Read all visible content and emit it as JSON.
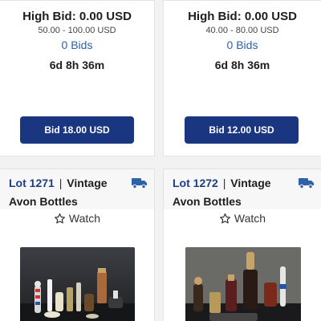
{
  "cards_top": [
    {
      "high_bid": "High Bid: 0.00 USD",
      "range": "50.00 - 100.00 USD",
      "bids": "0 Bids",
      "time_left": "6d 8h 36m",
      "bid_button": "Bid 18.00 USD"
    },
    {
      "high_bid": "High Bid: 0.00 USD",
      "range": "40.00 - 80.00 USD",
      "bids": "0 Bids",
      "time_left": "6d 8h 36m",
      "bid_button": "Bid 12.00 USD"
    }
  ],
  "cards_bottom": [
    {
      "lot": "Lot 1271",
      "separator": "|",
      "title_line1": "Vintage",
      "title_line2": "Avon Bottles",
      "watch": "Watch",
      "icon": "shipping-truck-icon"
    },
    {
      "lot": "Lot 1272",
      "separator": "|",
      "title_line1": "Vintage",
      "title_line2": "Avon Bottles",
      "watch": "Watch",
      "icon": "shipping-truck-icon"
    }
  ],
  "colors": {
    "button": "#1a3680",
    "link": "#2d62a6",
    "lot_number": "#1d3d86"
  }
}
